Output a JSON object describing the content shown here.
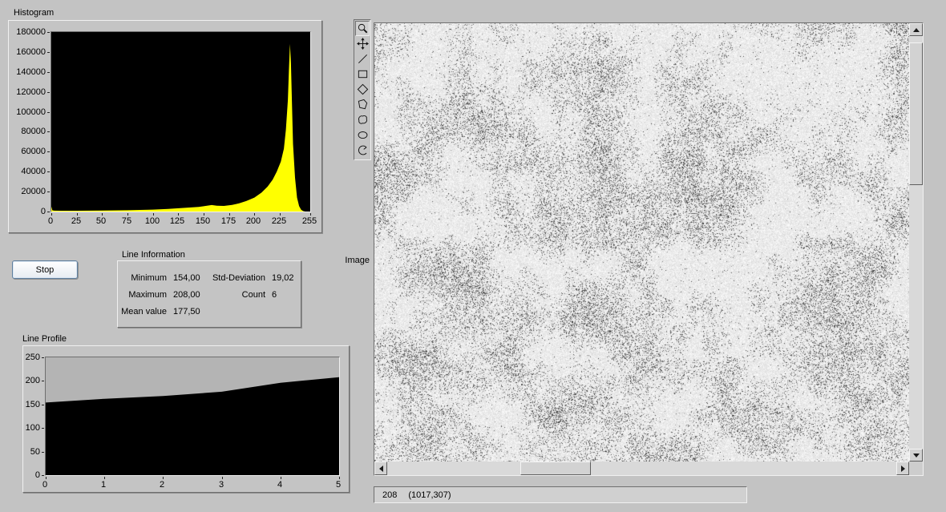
{
  "window": {
    "background_color": "#c3c3c3"
  },
  "histogram": {
    "label": "Histogram"
  },
  "stop_button": {
    "label": "Stop"
  },
  "line_information": {
    "title": "Line Information",
    "rows": [
      {
        "label": "Minimum",
        "value": "154,00",
        "label2": "Std-Deviation",
        "value2": "19,02"
      },
      {
        "label": "Maximum",
        "value": "208,00",
        "label2": "Count",
        "value2": "6"
      },
      {
        "label": "Mean value",
        "value": "177,50",
        "label2": "",
        "value2": ""
      }
    ]
  },
  "line_profile": {
    "label": "Line Profile"
  },
  "image_panel": {
    "label": "Image"
  },
  "toolbar": {
    "tools": [
      "zoom",
      "pan",
      "line",
      "rectangle",
      "rotated-rectangle",
      "polygon",
      "freehand",
      "oval",
      "annulus"
    ]
  },
  "status_bar": {
    "pixel_value": "208",
    "coordinates": "(1017,307)"
  },
  "chart_data": [
    {
      "id": "histogram",
      "type": "area",
      "title": "Histogram",
      "xlabel": "",
      "ylabel": "",
      "xlim": [
        0,
        255
      ],
      "ylim": [
        0,
        180000
      ],
      "x_ticks": [
        0,
        25,
        50,
        75,
        100,
        125,
        150,
        175,
        200,
        225,
        255
      ],
      "y_ticks": [
        0,
        20000,
        40000,
        60000,
        80000,
        100000,
        120000,
        140000,
        160000,
        180000
      ],
      "plot_bg": "#000000",
      "fill": "#ffff00",
      "grid": false,
      "x": [
        0,
        1,
        3,
        10,
        25,
        50,
        75,
        100,
        115,
        130,
        145,
        152,
        158,
        163,
        170,
        178,
        185,
        192,
        200,
        207,
        213,
        218,
        222,
        226,
        229,
        231,
        233,
        234,
        235,
        236,
        237,
        238,
        240,
        242,
        244,
        246,
        248,
        250,
        255
      ],
      "values": [
        5000,
        1200,
        900,
        800,
        800,
        1000,
        1300,
        1900,
        2600,
        3600,
        4700,
        5600,
        6500,
        5900,
        5600,
        6600,
        8200,
        10500,
        14000,
        19000,
        25000,
        32000,
        40000,
        50000,
        63000,
        82000,
        112000,
        142000,
        168000,
        149000,
        108000,
        68000,
        34000,
        14000,
        5500,
        1800,
        500,
        0,
        0
      ]
    },
    {
      "id": "line_profile",
      "type": "area",
      "title": "Line Profile",
      "xlabel": "",
      "ylabel": "",
      "xlim": [
        0,
        5
      ],
      "ylim": [
        0,
        250
      ],
      "x_ticks": [
        0,
        1,
        2,
        3,
        4,
        5
      ],
      "y_ticks": [
        0,
        50,
        100,
        150,
        200,
        250
      ],
      "plot_bg": "#b4b4b4",
      "fill": "#000000",
      "grid": false,
      "x": [
        0,
        1,
        2,
        3,
        4,
        5
      ],
      "values": [
        154,
        162,
        168,
        177,
        196,
        208
      ]
    }
  ]
}
